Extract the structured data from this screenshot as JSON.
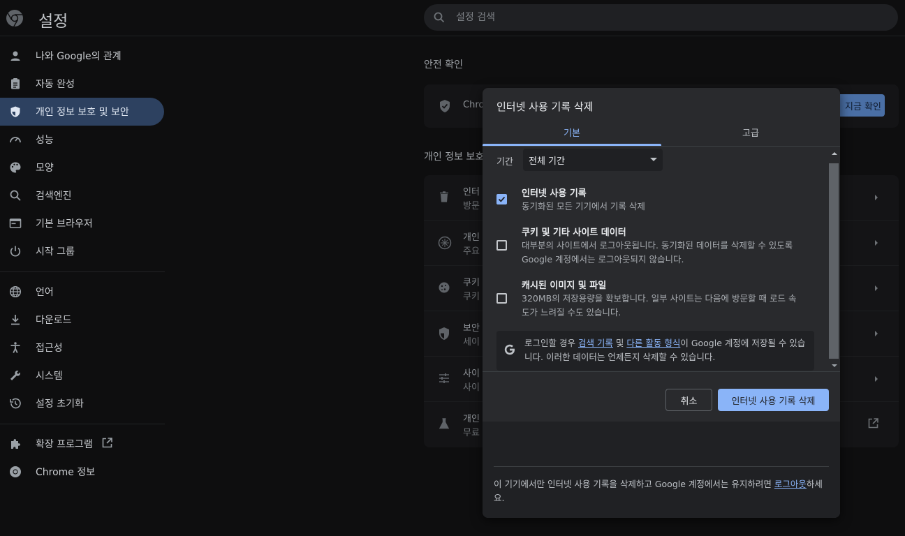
{
  "header": {
    "title": "설정",
    "search_placeholder": "설정 검색"
  },
  "sidebar": {
    "items": [
      {
        "label": "나와 Google의 관계",
        "icon": "person-icon"
      },
      {
        "label": "자동 완성",
        "icon": "clipboard-icon"
      },
      {
        "label": "개인 정보 보호 및 보안",
        "icon": "shield-icon",
        "active": true
      },
      {
        "label": "성능",
        "icon": "speedometer-icon"
      },
      {
        "label": "모양",
        "icon": "palette-icon"
      },
      {
        "label": "검색엔진",
        "icon": "search-icon"
      },
      {
        "label": "기본 브라우저",
        "icon": "browser-icon"
      },
      {
        "label": "시작 그룹",
        "icon": "power-icon"
      }
    ],
    "items2": [
      {
        "label": "언어",
        "icon": "globe-icon"
      },
      {
        "label": "다운로드",
        "icon": "download-icon"
      },
      {
        "label": "접근성",
        "icon": "accessibility-icon"
      },
      {
        "label": "시스템",
        "icon": "wrench-icon"
      },
      {
        "label": "설정 초기화",
        "icon": "reset-icon"
      }
    ],
    "extensions_label": "확장 프로그램",
    "about_label": "Chrome 정보"
  },
  "main": {
    "safety_title": "안전 확인",
    "safety_text": "Chro",
    "safety_button": "지금 확인",
    "privacy_title": "개인 정보 보호",
    "rows": [
      {
        "t1": "인터",
        "t2": "방문"
      },
      {
        "t1": "개인",
        "t2": "주요"
      },
      {
        "t1": "쿠키",
        "t2": "쿠키"
      },
      {
        "t1": "보안",
        "t2": "세이"
      },
      {
        "t1": "사이",
        "t2": "사이"
      },
      {
        "t1": "개인",
        "t2": "무료"
      }
    ]
  },
  "dialog": {
    "title": "인터넷 사용 기록 삭제",
    "tabs": [
      "기본",
      "고급"
    ],
    "period_label": "기간",
    "period_value": "전체 기간",
    "options": [
      {
        "title": "인터넷 사용 기록",
        "desc": "동기화된 모든 기기에서 기록 삭제",
        "checked": true
      },
      {
        "title": "쿠키 및 기타 사이트 데이터",
        "desc": "대부분의 사이트에서 로그아웃됩니다. 동기화된 데이터를 삭제할 수 있도록 Google 계정에서는 로그아웃되지 않습니다.",
        "checked": false
      },
      {
        "title": "캐시된 이미지 및 파일",
        "desc": "320MB의 저장용량을 확보합니다. 일부 사이트는 다음에 방문할 때 로드 속도가 느려질 수도 있습니다.",
        "checked": false
      }
    ],
    "google_note": {
      "pre": "로그인할 경우 ",
      "link1": "검색 기록",
      "mid": " 및 ",
      "link2": "다른 활동 형식",
      "post": "이 Google 계정에 저장될 수 있습니다. 이러한 데이터는 언제든지 삭제할 수 있습니다."
    },
    "cancel_label": "취소",
    "clear_label": "인터넷 사용 기록 삭제",
    "footer": {
      "pre": "이 기기에서만 인터넷 사용 기록을 삭제하고 Google 계정에서는 유지하려면 ",
      "link": "로그아웃",
      "post": "하세요."
    }
  },
  "colors": {
    "accent": "#8ab4f8",
    "active_nav": "#2d4160",
    "dialog_bg": "#292a2d"
  }
}
